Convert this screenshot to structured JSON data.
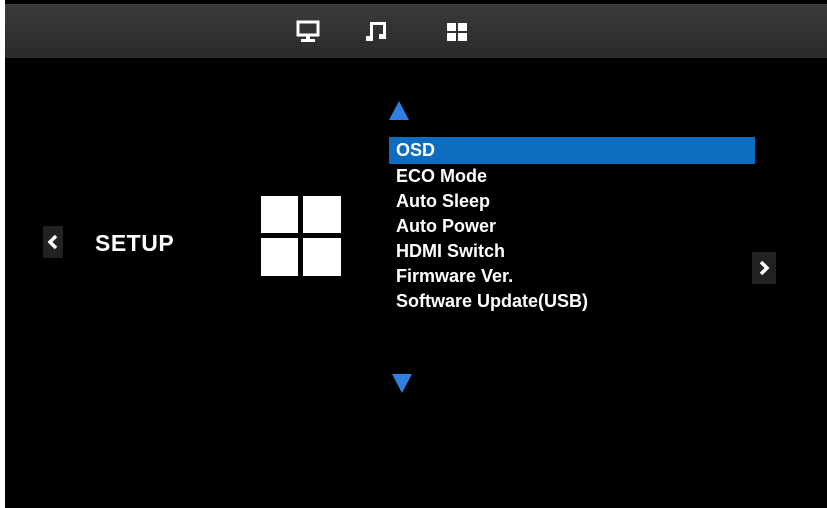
{
  "colors": {
    "background": "#000000",
    "topbar": "#2f2f2f",
    "highlight": "#0b6cc0",
    "arrow_blue": "#2e7fe0",
    "text": "#ffffff"
  },
  "topbar": {
    "icons": [
      "monitor-icon",
      "music-note-icon",
      "setup-grid-icon"
    ],
    "active_icon": "setup-grid-icon"
  },
  "section": {
    "title": "SETUP",
    "icon": "setup-grid-icon"
  },
  "menu": {
    "selected_index": 0,
    "items": [
      {
        "label": "OSD"
      },
      {
        "label": "ECO Mode"
      },
      {
        "label": "Auto Sleep"
      },
      {
        "label": "Auto Power"
      },
      {
        "label": "HDMI Switch"
      },
      {
        "label": "Firmware Ver."
      },
      {
        "label": "Software Update(USB)"
      }
    ]
  },
  "nav": {
    "left_glyph": "‹",
    "right_glyph": "›"
  }
}
